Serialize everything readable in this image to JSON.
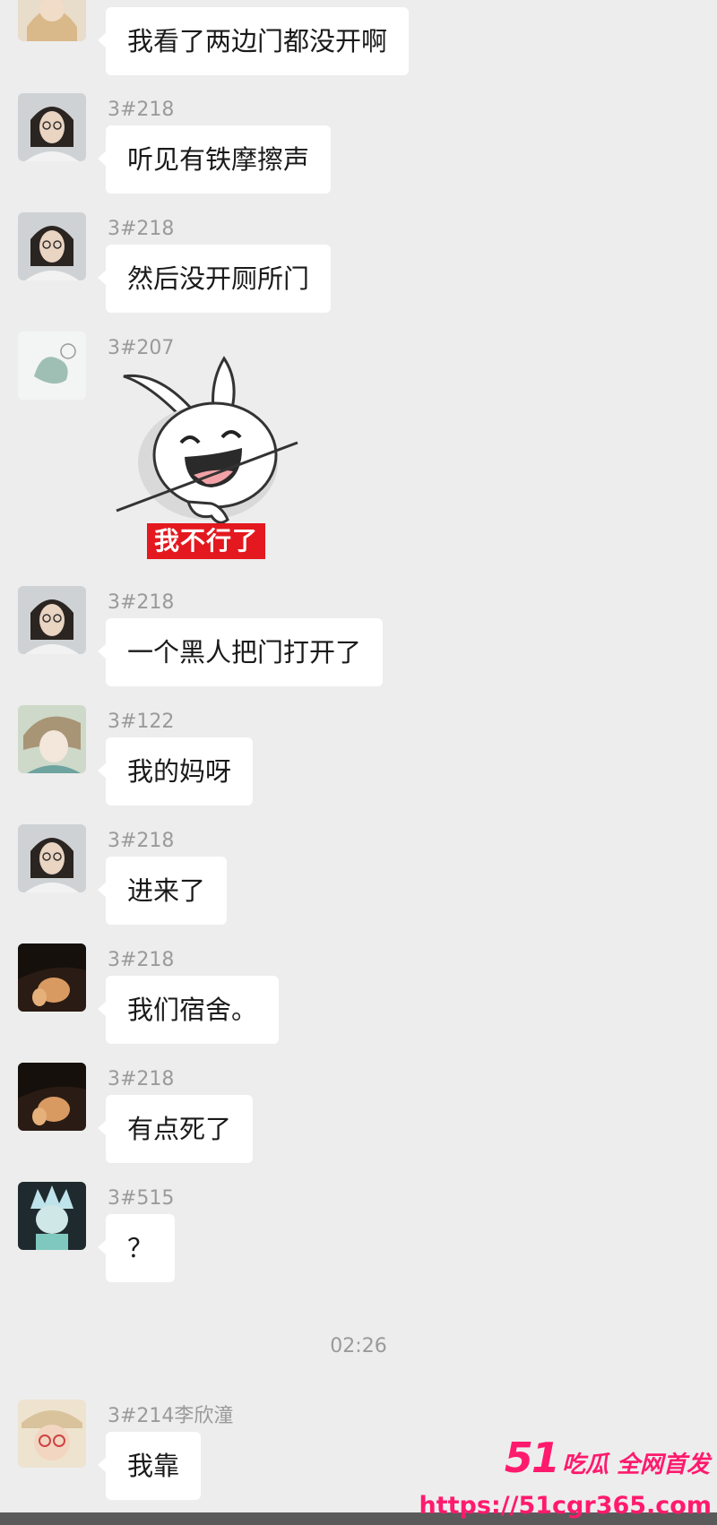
{
  "messages": [
    {
      "sender": "",
      "text": "我看了两边门都没开啊",
      "avatar": "avatar-girl-blonde-icon"
    },
    {
      "sender": "3#218",
      "text": "听见有铁摩擦声",
      "avatar": "avatar-girl-glasses-icon"
    },
    {
      "sender": "3#218",
      "text": "然后没开厕所门",
      "avatar": "avatar-girl-glasses-icon"
    },
    {
      "sender": "3#207",
      "sticker_caption": "我不行了",
      "avatar": "avatar-sketch-icon"
    },
    {
      "sender": "3#218",
      "text": "一个黑人把门打开了",
      "avatar": "avatar-girl-glasses-icon"
    },
    {
      "sender": "3#122",
      "text": "我的妈呀",
      "avatar": "avatar-anime-boy-icon"
    },
    {
      "sender": "3#218",
      "text": "进来了",
      "avatar": "avatar-girl-glasses-icon"
    },
    {
      "sender": "3#218",
      "text": "我们宿舍。",
      "avatar": "avatar-dark-photo-icon"
    },
    {
      "sender": "3#218",
      "text": "有点死了",
      "avatar": "avatar-dark-photo-icon"
    },
    {
      "sender": "3#515",
      "text": "？",
      "avatar": "avatar-cartoon-scientist-icon"
    },
    {
      "sender": "3#214李欣潼",
      "text": "我靠",
      "avatar": "avatar-hat-girl-icon"
    }
  ],
  "timestamp": "02:26",
  "watermark": {
    "brand_number": "51",
    "brand_text": "吃瓜 全网首发",
    "url": "https://51cgr365.com"
  },
  "colors": {
    "background": "#ededed",
    "bubble": "#ffffff",
    "watermark": "#ff1a6d",
    "sticker_caption_bg": "#e3191f"
  }
}
